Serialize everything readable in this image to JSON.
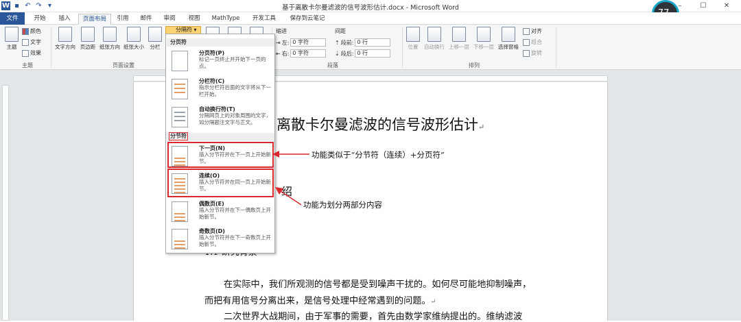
{
  "window": {
    "title": "基于离散卡尔曼滤波的信号波形估计.docx - Microsoft Word",
    "controls": [
      "–",
      "☐",
      "✕"
    ]
  },
  "cpu_badge": {
    "value": "77",
    "unit": "%"
  },
  "tabs": [
    "文件",
    "开始",
    "插入",
    "页面布局",
    "引用",
    "邮件",
    "审阅",
    "视图",
    "MathType",
    "开发工具",
    "保存到云笔记"
  ],
  "active_tab": "页面布局",
  "ribbon": {
    "theme_group": {
      "label": "主题",
      "theme_button": "主题",
      "colors": "颜色",
      "fonts": "文字",
      "effects": "效果"
    },
    "page_setup_group": {
      "label": "页面设置",
      "buttons": [
        "文字方向",
        "页边距",
        "纸张方向",
        "纸张大小",
        "分栏"
      ],
      "breaks_button": "分隔符"
    },
    "paragraph_group": {
      "label": "段落",
      "indent_label": "缩进",
      "spacing_label": "间距",
      "indent_left_label": "左:",
      "indent_left_value": "0 字符",
      "indent_right_label": "右:",
      "indent_right_value": "0 字符",
      "spacing_before_label": "段前:",
      "spacing_before_value": "0 行",
      "spacing_after_label": "段后:",
      "spacing_after_value": "0 行"
    },
    "arrange_group": {
      "label": "排列",
      "buttons": [
        "位置",
        "自动换行",
        "上移一层",
        "下移一层",
        "选择窗格"
      ],
      "align": "对齐",
      "group": "组合",
      "rotate": "旋转"
    }
  },
  "breaks_menu": {
    "page_breaks_header": "分页符",
    "section_breaks_header": "分节符",
    "items": [
      {
        "title": "分页符(P)",
        "desc": "标记一页终止并开始下一页的点。"
      },
      {
        "title": "分栏符(C)",
        "desc": "指示分栏符后面的文字将从下一栏开始。"
      },
      {
        "title": "自动换行符(T)",
        "desc": "分隔网页上的对象周围的文字，如分隔题注文字与正文。"
      },
      {
        "title": "下一页(N)",
        "desc": "插入分节符并在下一页上开始新节。"
      },
      {
        "title": "连续(O)",
        "desc": "插入分节符并在同一页上开始新节。"
      },
      {
        "title": "偶数页(E)",
        "desc": "插入分节符并在下一偶数页上开始新节。"
      },
      {
        "title": "奇数页(D)",
        "desc": "插入分节符并在下一奇数页上开始新节。"
      }
    ]
  },
  "document": {
    "title": "离散卡尔曼滤波的信号波形估计",
    "para_mark": "↵",
    "fragment_intro": "绍",
    "fragment_heading": "1.1  研究背景",
    "lines": [
      "在实际中，我们所观测的信号都是受到噪声干扰的。如何尽可能地抑制噪声，",
      "而把有用信号分离出来，是信号处理中经常遇到的问题。",
      "二次世界大战期间，由于军事的需要，首先由数学家维纳提出的。维纳滤波"
    ]
  },
  "annotations": {
    "next_page": "功能类似于“分节符（连续）+分页符”",
    "continuous": "功能为划分两部分内容"
  }
}
